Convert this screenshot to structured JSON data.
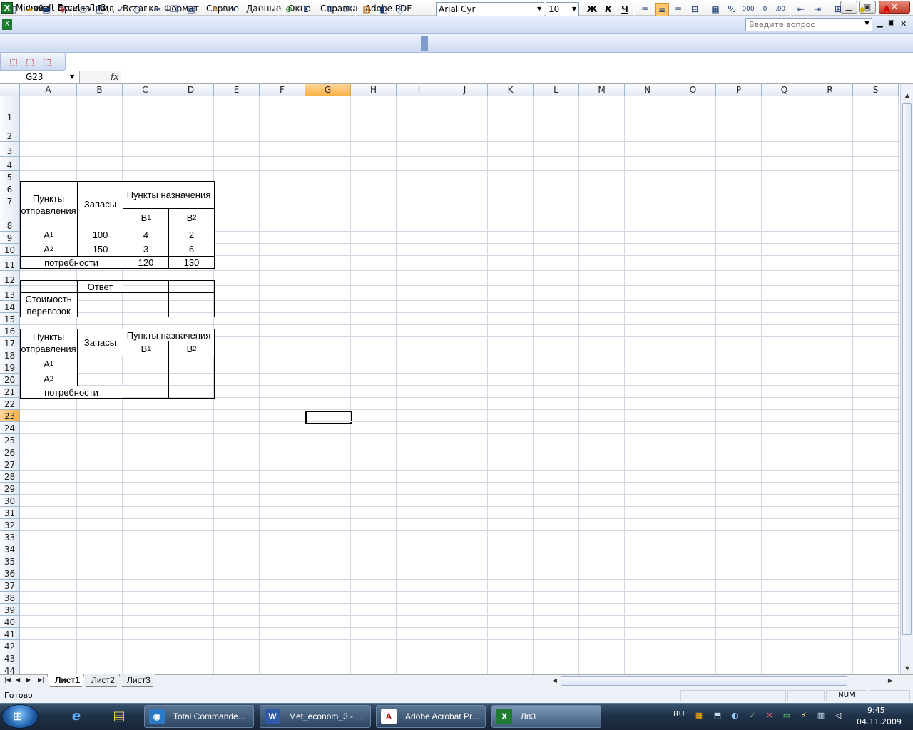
{
  "window": {
    "title": "Microsoft Excel - Лп3",
    "app_icon": "excel-icon",
    "buttons": {
      "minimize": "▁",
      "maximize": "▣",
      "close": "✕"
    }
  },
  "menu": {
    "items": [
      "Файл",
      "Правка",
      "Вид",
      "Вставка",
      "Формат",
      "Сервис",
      "Данные",
      "Окно",
      "Справка",
      "Adobe PDF"
    ],
    "help_placeholder": "Введите вопрос",
    "doc_buttons": {
      "minimize": "▁",
      "restore": "▣",
      "close": "✕"
    }
  },
  "toolbar": {
    "font_name": "Arial Cyr",
    "font_size": "10",
    "bold": "Ж",
    "italic": "К",
    "underline": "Ч",
    "percent": "%",
    "thousands": "000",
    "increase_decimal": ",0",
    "decrease_decimal": ",00",
    "sum": "Σ",
    "icons": [
      "new-icon",
      "open-icon",
      "save-icon",
      "permission-icon",
      "print-icon",
      "print-preview-icon",
      "spelling-icon",
      "research-icon",
      "cut-icon",
      "copy-icon",
      "paste-icon",
      "format-painter-icon",
      "undo-icon",
      "redo-icon",
      "hyperlink-icon",
      "autosum-icon",
      "sort-ascending-icon",
      "sort-descending-icon",
      "chart-wizard-icon",
      "drawing-icon",
      "help-icon"
    ]
  },
  "pdf_toolbar": {
    "icons": [
      "pdf-convert-icon",
      "pdf-email-icon",
      "pdf-review-icon"
    ]
  },
  "formula_bar": {
    "name_box": "G23",
    "fx": "fx",
    "formula": ""
  },
  "colors": {
    "selection_header": "#f8b348",
    "grid_line": "#d0d7e5",
    "header_bg": "#e3e8f2",
    "taskbar": "#1f3249"
  },
  "grid": {
    "columns": [
      "A",
      "B",
      "C",
      "D",
      "E",
      "F",
      "G",
      "H",
      "I",
      "J",
      "K",
      "L",
      "M",
      "N",
      "O",
      "P",
      "Q",
      "R",
      "S"
    ],
    "rows": [
      "1",
      "2",
      "3",
      "4",
      "5",
      "6",
      "7",
      "8",
      "9",
      "10",
      "11",
      "12",
      "13",
      "14",
      "15",
      "16",
      "17",
      "18",
      "19",
      "20",
      "21",
      "22",
      "23",
      "24",
      "25",
      "26",
      "27",
      "28",
      "29",
      "30",
      "31",
      "32",
      "33",
      "34",
      "35",
      "36",
      "37",
      "38",
      "39",
      "40",
      "41",
      "42",
      "43",
      "44"
    ],
    "selected_column": "G",
    "selected_row": "23",
    "cells": {
      "supply_points": "Пункты отправления",
      "stocks": "Запасы",
      "destinations": "Пункты назначения",
      "b1": "B",
      "b1_sub": "1",
      "b2": "B",
      "b2_sub": "2",
      "a1": "A",
      "a1_sub": "1",
      "a2": "A",
      "a2_sub": "2",
      "stock_a1": "100",
      "stock_a2": "150",
      "cost_a1_b1": "4",
      "cost_a1_b2": "2",
      "cost_a2_b1": "3",
      "cost_a2_b2": "6",
      "demand_label": "потребности",
      "demand_b1": "120",
      "demand_b2": "130",
      "answer": "Ответ",
      "transport_cost": "Стоимость перевозок",
      "supply_points_2": "Пункты отправления",
      "stocks_2": "Запасы",
      "destinations_2": "Пункты назначения",
      "demand_label_2": "потребности"
    }
  },
  "sheets": {
    "tabs": [
      "Лист1",
      "Лист2",
      "Лист3"
    ],
    "active": "Лист1"
  },
  "status": {
    "text": "Готово",
    "num": "NUM"
  },
  "taskbar": {
    "quick_launch": [
      "ie-icon",
      "explorer-icon"
    ],
    "tasks": [
      {
        "label": "Total Commande...",
        "icon": "total-commander-icon"
      },
      {
        "label": "Met_econom_3 - ...",
        "icon": "word-icon"
      },
      {
        "label": "Adobe Acrobat Pr...",
        "icon": "acrobat-icon"
      },
      {
        "label": "Лп3",
        "icon": "excel-icon"
      }
    ],
    "language": "RU",
    "time": "9:45",
    "date": "04.11.2009"
  }
}
